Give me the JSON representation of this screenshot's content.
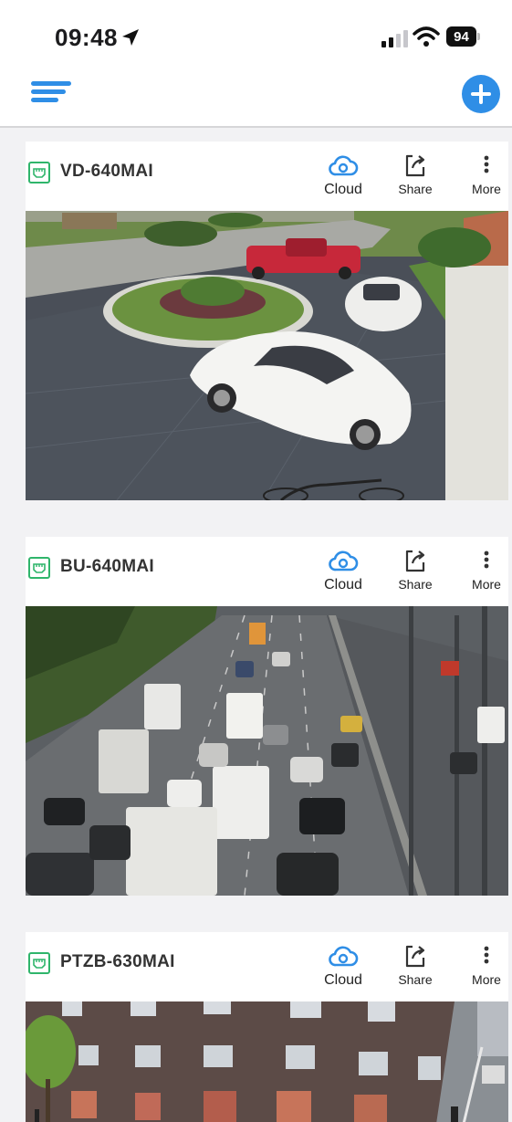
{
  "status_bar": {
    "time": "09:48",
    "battery": "94"
  },
  "nav": {
    "menu_icon": "hamburger-menu-icon",
    "add_icon": "plus-circle-icon",
    "accent_color": "#2f8ee6"
  },
  "cameras": [
    {
      "name": "VD-640MAI",
      "actions": {
        "cloud": "Cloud",
        "share": "Share",
        "more": "More"
      },
      "scene": "driveway"
    },
    {
      "name": "BU-640MAI",
      "actions": {
        "cloud": "Cloud",
        "share": "Share",
        "more": "More"
      },
      "scene": "highway"
    },
    {
      "name": "PTZB-630MAI",
      "actions": {
        "cloud": "Cloud",
        "share": "Share",
        "more": "More"
      },
      "scene": "building"
    }
  ]
}
